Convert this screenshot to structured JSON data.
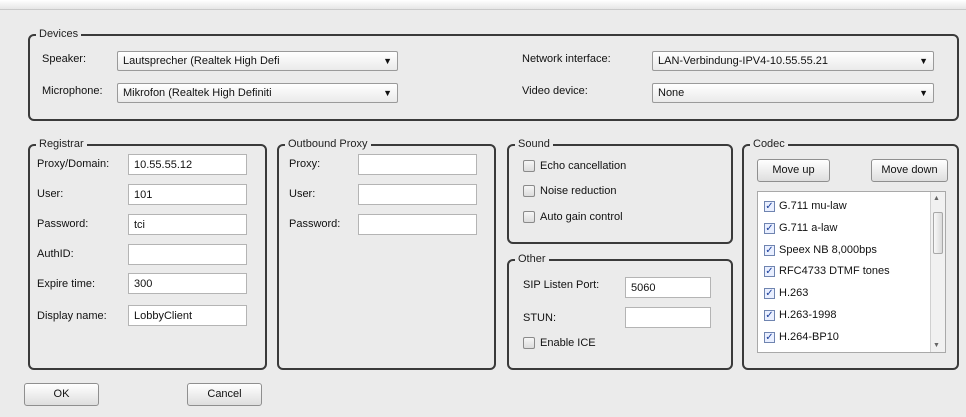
{
  "devices": {
    "title": "Devices",
    "speaker_label": "Speaker:",
    "speaker_value": "Lautsprecher (Realtek High Defi",
    "microphone_label": "Microphone:",
    "microphone_value": "Mikrofon (Realtek High Definiti",
    "network_label": "Network interface:",
    "network_value": "LAN-Verbindung-IPV4-10.55.55.21",
    "video_label": "Video device:",
    "video_value": "None"
  },
  "registrar": {
    "title": "Registrar",
    "proxy_label": "Proxy/Domain:",
    "proxy_value": "10.55.55.12",
    "user_label": "User:",
    "user_value": "101",
    "password_label": "Password:",
    "password_value": "tci",
    "authid_label": "AuthID:",
    "authid_value": "",
    "expire_label": "Expire time:",
    "expire_value": "300",
    "display_label": "Display name:",
    "display_value": "LobbyClient"
  },
  "outbound": {
    "title": "Outbound Proxy",
    "proxy_label": "Proxy:",
    "proxy_value": "",
    "user_label": "User:",
    "user_value": "",
    "password_label": "Password:",
    "password_value": ""
  },
  "sound": {
    "title": "Sound",
    "echo_label": "Echo cancellation",
    "noise_label": "Noise reduction",
    "gain_label": "Auto gain control"
  },
  "other": {
    "title": "Other",
    "sip_label": "SIP Listen Port:",
    "sip_value": "5060",
    "stun_label": "STUN:",
    "stun_value": "",
    "ice_label": "Enable ICE"
  },
  "codec": {
    "title": "Codec",
    "move_up": "Move up",
    "move_down": "Move down",
    "items": [
      {
        "label": "G.711 mu-law",
        "checked": true
      },
      {
        "label": "G.711 a-law",
        "checked": true
      },
      {
        "label": "Speex NB   8,000bps",
        "checked": true
      },
      {
        "label": "RFC4733 DTMF tones",
        "checked": true
      },
      {
        "label": "H.263",
        "checked": true
      },
      {
        "label": "H.263-1998",
        "checked": true
      },
      {
        "label": "H.264-BP10",
        "checked": true
      }
    ]
  },
  "buttons": {
    "ok": "OK",
    "cancel": "Cancel"
  }
}
